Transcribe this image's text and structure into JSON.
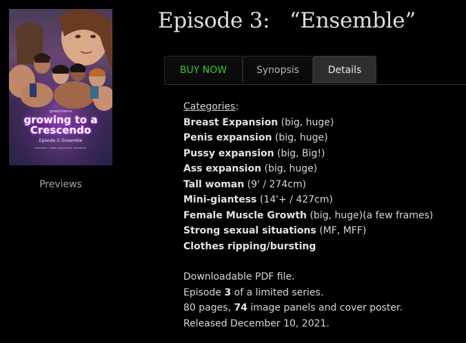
{
  "episode": {
    "title": "Episode 3:   “Ensemble”"
  },
  "poster": {
    "brand": "grow/cinema",
    "title_line1": "growing to a",
    "title_line2": "Crescendo",
    "subtitle": "Episode 3: Ensemble",
    "credits": "BUSTARTIST · CINEMA PRODUCTION · BUSTARTIST"
  },
  "previews_label": "Previews",
  "tabs": [
    {
      "label": "BUY NOW",
      "color": "#33cc33"
    },
    {
      "label": "Synopsis"
    },
    {
      "label": "Details",
      "active": true
    }
  ],
  "categories": {
    "heading": "Categories",
    "heading_suffix": ":",
    "items": [
      {
        "name": "Breast Expansion",
        "detail": " (big, huge)"
      },
      {
        "name": "Penis expansion",
        "detail": " (big, huge)"
      },
      {
        "name": "Pussy expansion",
        "detail": " (big, Big!)"
      },
      {
        "name": "Ass expansion",
        "detail": " (big, huge)"
      },
      {
        "name": "Tall woman",
        "detail": " (9' / 274cm)"
      },
      {
        "name": "Mini-giantess",
        "detail": " (14'+ / 427cm)"
      },
      {
        "name": "Female Muscle Growth",
        "detail": " (big, huge)(a few frames)"
      },
      {
        "name": "Strong sexual situations",
        "detail": " (MF, MFF)"
      },
      {
        "name": "Clothes ripping/bursting",
        "detail": ""
      }
    ]
  },
  "info": {
    "file_type": "Downloadable PDF file.",
    "episode_prefix": "Episode ",
    "episode_number": "3",
    "episode_suffix": " of a limited series.",
    "pages_prefix": "80 pages, ",
    "panels": "74",
    "pages_suffix": " image panels and cover poster.",
    "released": "Released December 10, 2021."
  }
}
